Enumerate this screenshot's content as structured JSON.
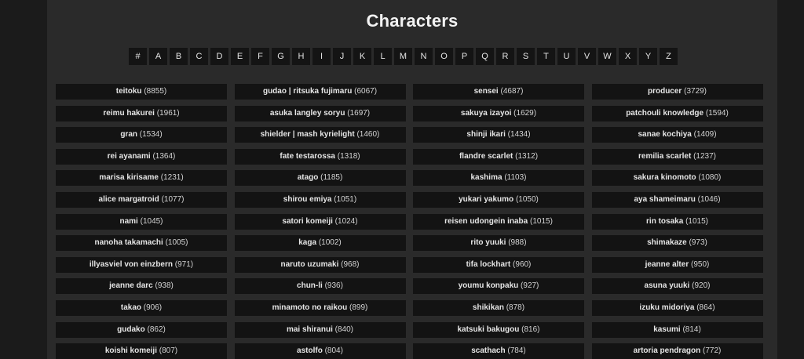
{
  "page": {
    "title": "Characters"
  },
  "letters": [
    "#",
    "A",
    "B",
    "C",
    "D",
    "E",
    "F",
    "G",
    "H",
    "I",
    "J",
    "K",
    "L",
    "M",
    "N",
    "O",
    "P",
    "Q",
    "R",
    "S",
    "T",
    "U",
    "V",
    "W",
    "X",
    "Y",
    "Z"
  ],
  "characters": [
    {
      "name": "teitoku",
      "count": "(8855)"
    },
    {
      "name": "gudao | ritsuka fujimaru",
      "count": "(6067)"
    },
    {
      "name": "sensei",
      "count": "(4687)"
    },
    {
      "name": "producer",
      "count": "(3729)"
    },
    {
      "name": "reimu hakurei",
      "count": "(1961)"
    },
    {
      "name": "asuka langley soryu",
      "count": "(1697)"
    },
    {
      "name": "sakuya izayoi",
      "count": "(1629)"
    },
    {
      "name": "patchouli knowledge",
      "count": "(1594)"
    },
    {
      "name": "gran",
      "count": "(1534)"
    },
    {
      "name": "shielder | mash kyrielight",
      "count": "(1460)"
    },
    {
      "name": "shinji ikari",
      "count": "(1434)"
    },
    {
      "name": "sanae kochiya",
      "count": "(1409)"
    },
    {
      "name": "rei ayanami",
      "count": "(1364)"
    },
    {
      "name": "fate testarossa",
      "count": "(1318)"
    },
    {
      "name": "flandre scarlet",
      "count": "(1312)"
    },
    {
      "name": "remilia scarlet",
      "count": "(1237)"
    },
    {
      "name": "marisa kirisame",
      "count": "(1231)"
    },
    {
      "name": "atago",
      "count": "(1185)"
    },
    {
      "name": "kashima",
      "count": "(1103)"
    },
    {
      "name": "sakura kinomoto",
      "count": "(1080)"
    },
    {
      "name": "alice margatroid",
      "count": "(1077)"
    },
    {
      "name": "shirou emiya",
      "count": "(1051)"
    },
    {
      "name": "yukari yakumo",
      "count": "(1050)"
    },
    {
      "name": "aya shameimaru",
      "count": "(1046)"
    },
    {
      "name": "nami",
      "count": "(1045)"
    },
    {
      "name": "satori komeiji",
      "count": "(1024)"
    },
    {
      "name": "reisen udongein inaba",
      "count": "(1015)"
    },
    {
      "name": "rin tosaka",
      "count": "(1015)"
    },
    {
      "name": "nanoha takamachi",
      "count": "(1005)"
    },
    {
      "name": "kaga",
      "count": "(1002)"
    },
    {
      "name": "rito yuuki",
      "count": "(988)"
    },
    {
      "name": "shimakaze",
      "count": "(973)"
    },
    {
      "name": "illyasviel von einzbern",
      "count": "(971)"
    },
    {
      "name": "naruto uzumaki",
      "count": "(968)"
    },
    {
      "name": "tifa lockhart",
      "count": "(960)"
    },
    {
      "name": "jeanne alter",
      "count": "(950)"
    },
    {
      "name": "jeanne darc",
      "count": "(938)"
    },
    {
      "name": "chun-li",
      "count": "(936)"
    },
    {
      "name": "youmu konpaku",
      "count": "(927)"
    },
    {
      "name": "asuna yuuki",
      "count": "(920)"
    },
    {
      "name": "takao",
      "count": "(906)"
    },
    {
      "name": "minamoto no raikou",
      "count": "(899)"
    },
    {
      "name": "shikikan",
      "count": "(878)"
    },
    {
      "name": "izuku midoriya",
      "count": "(864)"
    },
    {
      "name": "gudako",
      "count": "(862)"
    },
    {
      "name": "mai shiranui",
      "count": "(840)"
    },
    {
      "name": "katsuki bakugou",
      "count": "(816)"
    },
    {
      "name": "kasumi",
      "count": "(814)"
    },
    {
      "name": "koishi komeiji",
      "count": "(807)"
    },
    {
      "name": "astolfo",
      "count": "(804)"
    },
    {
      "name": "scathach",
      "count": "(784)"
    },
    {
      "name": "artoria pendragon",
      "count": "(772)"
    }
  ]
}
